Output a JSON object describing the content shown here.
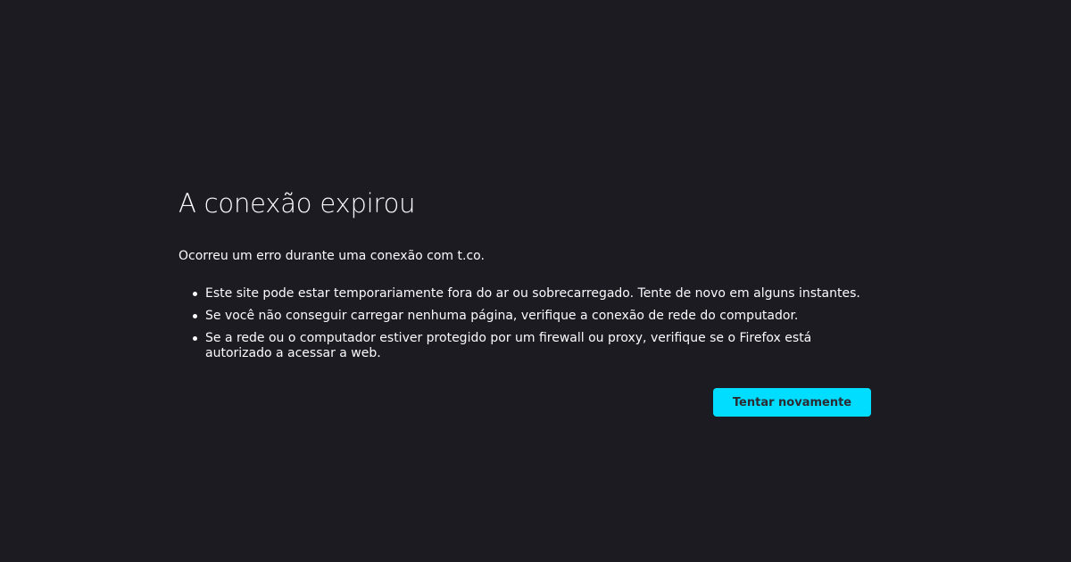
{
  "error": {
    "title": "A conexão expirou",
    "short_description": "Ocorreu um erro durante uma conexão com t.co.",
    "suggestions": [
      "Este site pode estar temporariamente fora do ar ou sobrecarregado. Tente de novo em alguns instantes.",
      "Se você não conseguir carregar nenhuma página, verifique a conexão de rede do computador.",
      "Se a rede ou o computador estiver protegido por um firewall ou proxy, verifique se o Firefox está autorizado a acessar a web."
    ],
    "retry_label": "Tentar novamente"
  },
  "colors": {
    "background": "#1c1b22",
    "text": "#fbfbfe",
    "accent": "#00ddff"
  }
}
